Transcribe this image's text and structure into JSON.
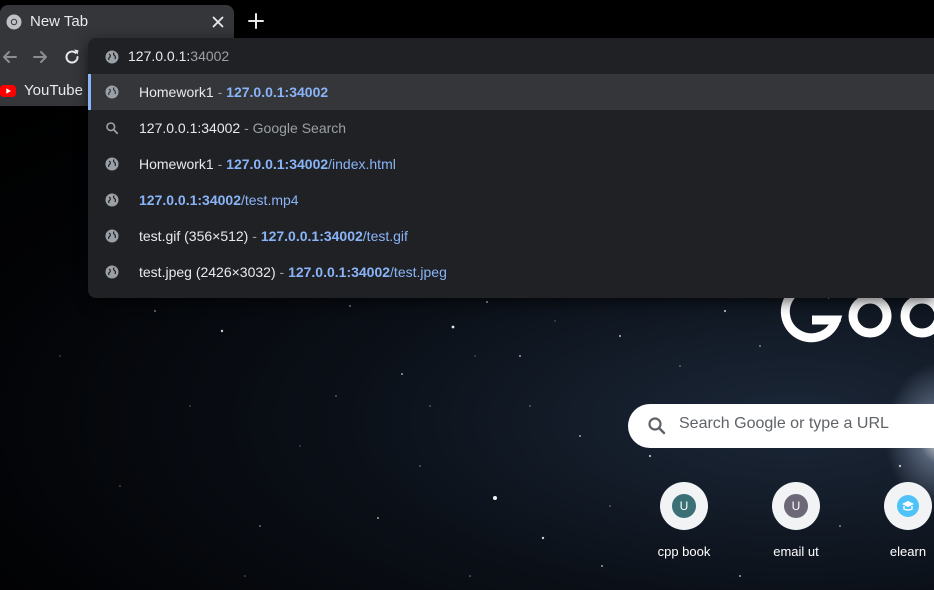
{
  "browser": {
    "tab": {
      "title": "New Tab",
      "close_icon": "close-icon",
      "favicon": "chrome-icon"
    },
    "new_tab_icon": "plus-icon"
  },
  "bookmarks": [
    {
      "label": "YouTube",
      "icon": "youtube-icon"
    }
  ],
  "omnibox": {
    "value_host": "127.0.0.1:",
    "value_port": "34002",
    "suggestions": [
      {
        "type": "history",
        "title": "Homework1",
        "separator": " - ",
        "url_host": "127.0.0.1:34002",
        "url_path": "",
        "selected": true
      },
      {
        "type": "search",
        "query": "127.0.0.1:34002",
        "separator": " - ",
        "provider": "Google Search"
      },
      {
        "type": "history",
        "title": "Homework1",
        "separator": " - ",
        "url_host": "127.0.0.1:34002",
        "url_path": "/index.html"
      },
      {
        "type": "url",
        "url_host": "127.0.0.1:34002",
        "url_path": "/test.mp4"
      },
      {
        "type": "history",
        "title": "test.gif (356×512)",
        "separator": " - ",
        "url_host": "127.0.0.1:34002",
        "url_path": "/test.gif"
      },
      {
        "type": "history",
        "title": "test.jpeg (2426×3032)",
        "separator": " - ",
        "url_host": "127.0.0.1:34002",
        "url_path": "/test.jpeg"
      }
    ]
  },
  "ntp": {
    "search_placeholder": "Search Google or type a URL",
    "shortcuts": [
      {
        "label": "cpp book",
        "avatar_letter": "U",
        "avatar_color": "#3b7077"
      },
      {
        "label": "email ut",
        "avatar_letter": "U",
        "avatar_color": "#6c6877"
      },
      {
        "label": "elearn",
        "avatar_letter": "",
        "avatar_color": "#4fc3f7"
      }
    ]
  },
  "colors": {
    "toolbar": "#35363a",
    "popup": "#202124",
    "link": "#8ab4f8",
    "selection_bar": "#8ab4f8"
  }
}
